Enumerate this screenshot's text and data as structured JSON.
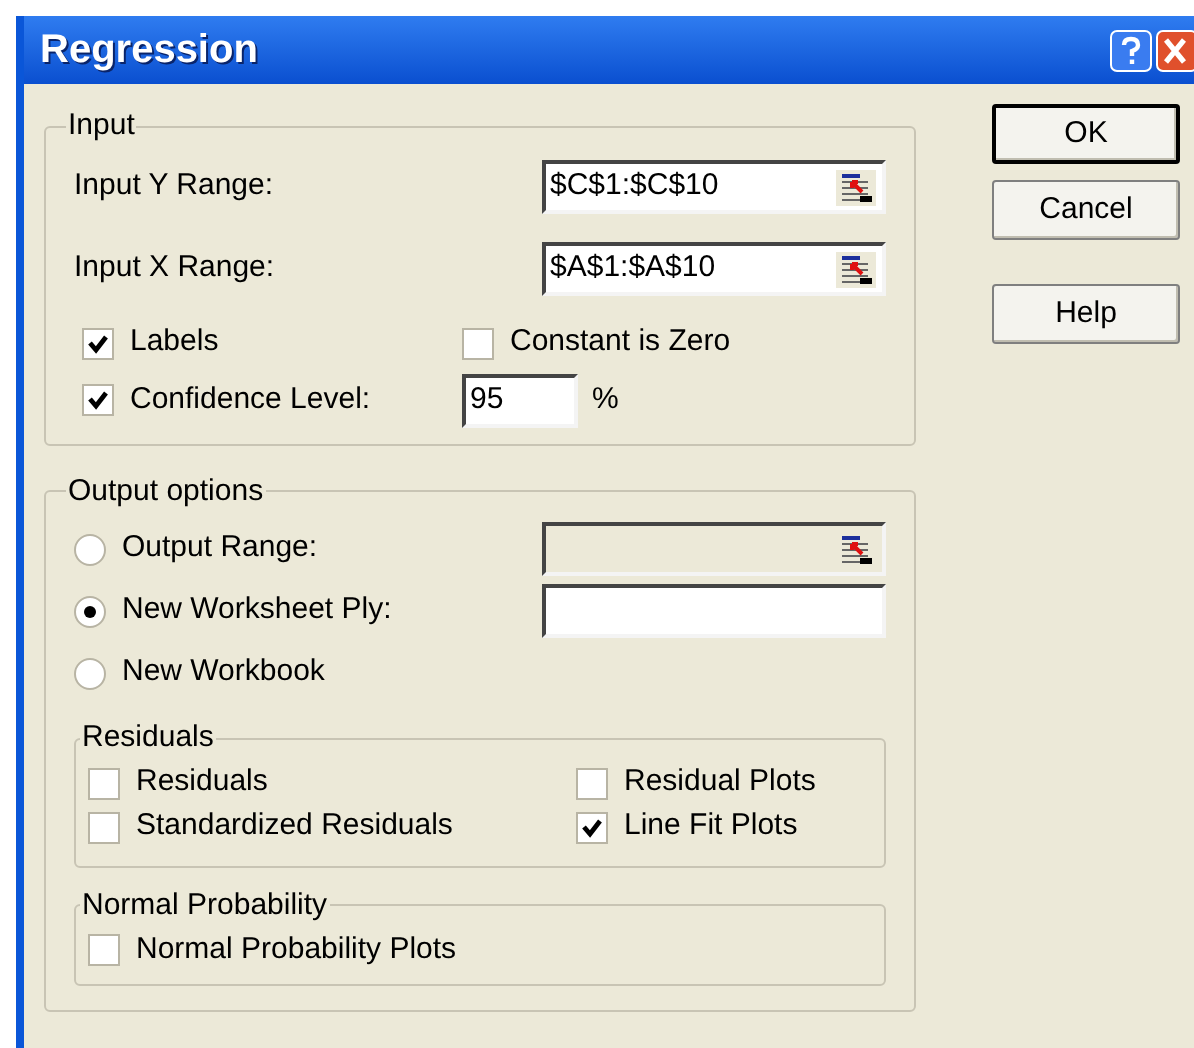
{
  "window": {
    "title": "Regression"
  },
  "input": {
    "title": "Input",
    "ranges": [
      {
        "label": "Input Y Range:",
        "value": "$C$1:$C$10"
      },
      {
        "label": "Input X Range:",
        "value": "$A$1:$A$10"
      }
    ],
    "options": [
      {
        "label": "Labels",
        "checked": true
      },
      {
        "label": "Constant is Zero",
        "checked": false
      }
    ],
    "confidence": {
      "label": "Confidence Level:",
      "checked": true,
      "value": "95",
      "unit": "%"
    }
  },
  "output": {
    "title": "Output options",
    "destinations": [
      {
        "label": "Output Range:",
        "selected": false,
        "field": {
          "kind": "range",
          "disabled": true
        }
      },
      {
        "label": "New Worksheet Ply:",
        "selected": true,
        "field": {
          "kind": "text",
          "disabled": false
        }
      },
      {
        "label": "New Workbook",
        "selected": false
      }
    ],
    "residuals": {
      "title": "Residuals",
      "options": [
        {
          "label": "Residuals",
          "checked": false
        },
        {
          "label": "Residual Plots",
          "checked": false
        },
        {
          "label": "Standardized Residuals",
          "checked": false
        },
        {
          "label": "Line Fit Plots",
          "checked": true
        }
      ]
    },
    "normal_probability": {
      "title": "Normal Probability",
      "options": [
        {
          "label": "Normal Probability Plots",
          "checked": false
        }
      ]
    }
  },
  "buttons": [
    "OK",
    "Cancel",
    "Help"
  ]
}
